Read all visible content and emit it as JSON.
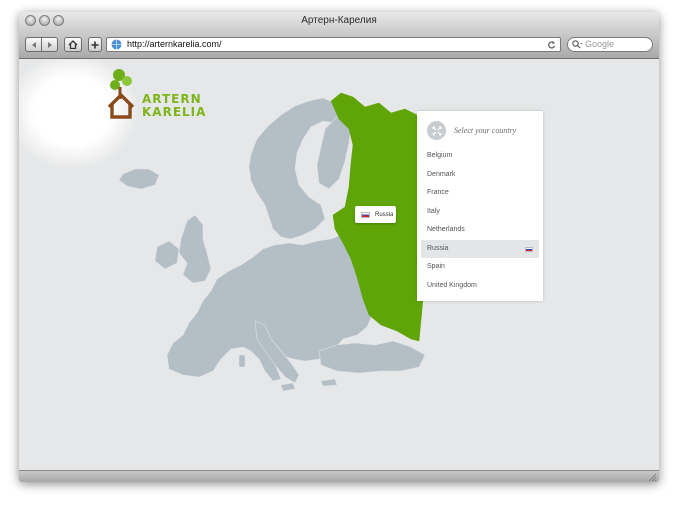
{
  "window": {
    "title": "Артерн-Карелия"
  },
  "toolbar": {
    "address": "http://arternkarelia.com/",
    "search_placeholder": "Google",
    "back_icon": "back-arrow-icon",
    "forward_icon": "forward-arrow-icon",
    "home_icon": "home-icon",
    "add_icon": "plus-icon",
    "reload_icon": "reload-icon"
  },
  "logo": {
    "line1": "ARTERN",
    "line2": "KARELIA",
    "icon": "tree-house-icon"
  },
  "map": {
    "highlight_color": "#5fa508",
    "land_color": "#b3bec5",
    "tooltip": {
      "label": "Russia",
      "flag": "russia-flag-icon"
    }
  },
  "country_panel": {
    "title": "Select your country",
    "icon": "expand-arrows-icon",
    "countries": [
      {
        "name": "Belgium",
        "selected": false
      },
      {
        "name": "Denmark",
        "selected": false
      },
      {
        "name": "France",
        "selected": false
      },
      {
        "name": "Italy",
        "selected": false
      },
      {
        "name": "Netherlands",
        "selected": false
      },
      {
        "name": "Russia",
        "selected": true
      },
      {
        "name": "Spain",
        "selected": false
      },
      {
        "name": "United Kingdom",
        "selected": false
      }
    ]
  }
}
